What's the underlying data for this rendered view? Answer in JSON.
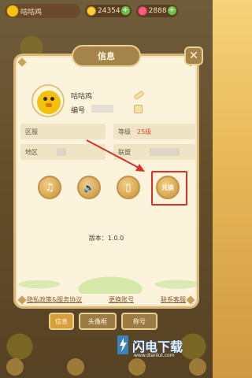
{
  "topbar": {
    "player_name": "咕咕鸡",
    "coins": "24354",
    "gems": "2888"
  },
  "panel": {
    "title": "信息",
    "close_glyph": "✕"
  },
  "profile": {
    "name": "咕咕鸡",
    "id_label": "编号"
  },
  "info": {
    "region_label": "区服",
    "level_label": "等级",
    "level_value": "25级",
    "area_label": "地区",
    "alliance_label": "联盟"
  },
  "buttons": {
    "music_glyph": "♫",
    "sound_glyph": "🔊",
    "vibrate_glyph": "▯",
    "exchange_label": "兑换"
  },
  "version": "版本：1.0.0",
  "links": {
    "privacy": "隐私政策&服务协议",
    "switch_account": "更换账号",
    "contact": "联系客服"
  },
  "tabs": [
    "信息",
    "头像框",
    "称号"
  ],
  "watermark": {
    "text": "闪电下载",
    "url": "www.dianlut.com"
  },
  "colors": {
    "accent_red": "#d8302a",
    "panel_bg": "#fbf3dc",
    "button_gold": "#d5a54e"
  }
}
